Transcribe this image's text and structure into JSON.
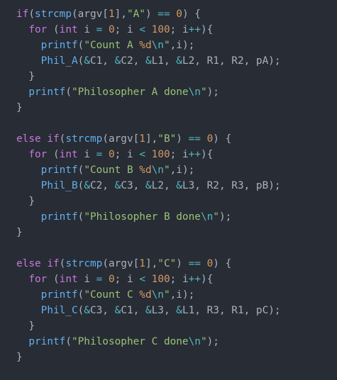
{
  "editor": {
    "theme_colors": {
      "background": "#282c34",
      "plain": "#abb2bf",
      "keyword": "#c678dd",
      "function": "#61afef",
      "string": "#98c379",
      "number": "#d19a66",
      "escape": "#56b6c2"
    },
    "lines": [
      [
        [
          "k",
          "if"
        ],
        [
          "p",
          "("
        ],
        [
          "f",
          "strcmp"
        ],
        [
          "p",
          "(argv["
        ],
        [
          "n",
          "1"
        ],
        [
          "p",
          "],"
        ],
        [
          "s",
          "\"A\""
        ],
        [
          "p",
          ") "
        ],
        [
          "e",
          "=="
        ],
        [
          "p",
          " "
        ],
        [
          "n",
          "0"
        ],
        [
          "p",
          ") {"
        ]
      ],
      [
        [
          "p",
          "  "
        ],
        [
          "k",
          "for"
        ],
        [
          "p",
          " ("
        ],
        [
          "k",
          "int"
        ],
        [
          "p",
          " i "
        ],
        [
          "e",
          "="
        ],
        [
          "p",
          " "
        ],
        [
          "n",
          "0"
        ],
        [
          "p",
          "; i "
        ],
        [
          "e",
          "<"
        ],
        [
          "p",
          " "
        ],
        [
          "n",
          "100"
        ],
        [
          "p",
          "; i"
        ],
        [
          "e",
          "++"
        ],
        [
          "p",
          "){"
        ]
      ],
      [
        [
          "p",
          "    "
        ],
        [
          "f",
          "printf"
        ],
        [
          "p",
          "("
        ],
        [
          "s",
          "\"Count A "
        ],
        [
          "n",
          "%d"
        ],
        [
          "e",
          "\\n"
        ],
        [
          "s",
          "\""
        ],
        [
          "p",
          ",i);"
        ]
      ],
      [
        [
          "p",
          "    "
        ],
        [
          "f",
          "Phil_A"
        ],
        [
          "p",
          "("
        ],
        [
          "e",
          "&"
        ],
        [
          "p",
          "C1, "
        ],
        [
          "e",
          "&"
        ],
        [
          "p",
          "C2, "
        ],
        [
          "e",
          "&"
        ],
        [
          "p",
          "L1, "
        ],
        [
          "e",
          "&"
        ],
        [
          "p",
          "L2, R1, R2, pA);"
        ]
      ],
      [
        [
          "p",
          "  }"
        ]
      ],
      [
        [
          "p",
          "  "
        ],
        [
          "f",
          "printf"
        ],
        [
          "p",
          "("
        ],
        [
          "s",
          "\"Philosopher A done"
        ],
        [
          "e",
          "\\n"
        ],
        [
          "s",
          "\""
        ],
        [
          "p",
          ");"
        ]
      ],
      [
        [
          "p",
          "}"
        ]
      ],
      [],
      [
        [
          "k",
          "else"
        ],
        [
          "p",
          " "
        ],
        [
          "k",
          "if"
        ],
        [
          "p",
          "("
        ],
        [
          "f",
          "strcmp"
        ],
        [
          "p",
          "(argv["
        ],
        [
          "n",
          "1"
        ],
        [
          "p",
          "],"
        ],
        [
          "s",
          "\"B\""
        ],
        [
          "p",
          ") "
        ],
        [
          "e",
          "=="
        ],
        [
          "p",
          " "
        ],
        [
          "n",
          "0"
        ],
        [
          "p",
          ") {"
        ]
      ],
      [
        [
          "p",
          "  "
        ],
        [
          "k",
          "for"
        ],
        [
          "p",
          " ("
        ],
        [
          "k",
          "int"
        ],
        [
          "p",
          " i "
        ],
        [
          "e",
          "="
        ],
        [
          "p",
          " "
        ],
        [
          "n",
          "0"
        ],
        [
          "p",
          "; i "
        ],
        [
          "e",
          "<"
        ],
        [
          "p",
          " "
        ],
        [
          "n",
          "100"
        ],
        [
          "p",
          "; i"
        ],
        [
          "e",
          "++"
        ],
        [
          "p",
          "){"
        ]
      ],
      [
        [
          "p",
          "    "
        ],
        [
          "f",
          "printf"
        ],
        [
          "p",
          "("
        ],
        [
          "s",
          "\"Count B "
        ],
        [
          "n",
          "%d"
        ],
        [
          "e",
          "\\n"
        ],
        [
          "s",
          "\""
        ],
        [
          "p",
          ",i);"
        ]
      ],
      [
        [
          "p",
          "    "
        ],
        [
          "f",
          "Phil_B"
        ],
        [
          "p",
          "("
        ],
        [
          "e",
          "&"
        ],
        [
          "p",
          "C2, "
        ],
        [
          "e",
          "&"
        ],
        [
          "p",
          "C3, "
        ],
        [
          "e",
          "&"
        ],
        [
          "p",
          "L2, "
        ],
        [
          "e",
          "&"
        ],
        [
          "p",
          "L3, R2, R3, pB);"
        ]
      ],
      [
        [
          "p",
          "  }"
        ]
      ],
      [
        [
          "p",
          "    "
        ],
        [
          "f",
          "printf"
        ],
        [
          "p",
          "("
        ],
        [
          "s",
          "\"Philosopher B done"
        ],
        [
          "e",
          "\\n"
        ],
        [
          "s",
          "\""
        ],
        [
          "p",
          ");"
        ]
      ],
      [
        [
          "p",
          "}"
        ]
      ],
      [],
      [
        [
          "k",
          "else"
        ],
        [
          "p",
          " "
        ],
        [
          "k",
          "if"
        ],
        [
          "p",
          "("
        ],
        [
          "f",
          "strcmp"
        ],
        [
          "p",
          "(argv["
        ],
        [
          "n",
          "1"
        ],
        [
          "p",
          "],"
        ],
        [
          "s",
          "\"C\""
        ],
        [
          "p",
          ") "
        ],
        [
          "e",
          "=="
        ],
        [
          "p",
          " "
        ],
        [
          "n",
          "0"
        ],
        [
          "p",
          ") {"
        ]
      ],
      [
        [
          "p",
          "  "
        ],
        [
          "k",
          "for"
        ],
        [
          "p",
          " ("
        ],
        [
          "k",
          "int"
        ],
        [
          "p",
          " i "
        ],
        [
          "e",
          "="
        ],
        [
          "p",
          " "
        ],
        [
          "n",
          "0"
        ],
        [
          "p",
          "; i "
        ],
        [
          "e",
          "<"
        ],
        [
          "p",
          " "
        ],
        [
          "n",
          "100"
        ],
        [
          "p",
          "; i"
        ],
        [
          "e",
          "++"
        ],
        [
          "p",
          "){"
        ]
      ],
      [
        [
          "p",
          "    "
        ],
        [
          "f",
          "printf"
        ],
        [
          "p",
          "("
        ],
        [
          "s",
          "\"Count C "
        ],
        [
          "n",
          "%d"
        ],
        [
          "e",
          "\\n"
        ],
        [
          "s",
          "\""
        ],
        [
          "p",
          ",i);"
        ]
      ],
      [
        [
          "p",
          "    "
        ],
        [
          "f",
          "Phil_C"
        ],
        [
          "p",
          "("
        ],
        [
          "e",
          "&"
        ],
        [
          "p",
          "C3, "
        ],
        [
          "e",
          "&"
        ],
        [
          "p",
          "C1, "
        ],
        [
          "e",
          "&"
        ],
        [
          "p",
          "L3, "
        ],
        [
          "e",
          "&"
        ],
        [
          "p",
          "L1, R3, R1, pC);"
        ]
      ],
      [
        [
          "p",
          "  }"
        ]
      ],
      [
        [
          "p",
          "  "
        ],
        [
          "f",
          "printf"
        ],
        [
          "p",
          "("
        ],
        [
          "s",
          "\"Philosopher C done"
        ],
        [
          "e",
          "\\n"
        ],
        [
          "s",
          "\""
        ],
        [
          "p",
          ");"
        ]
      ],
      [
        [
          "p",
          "}"
        ]
      ]
    ]
  }
}
